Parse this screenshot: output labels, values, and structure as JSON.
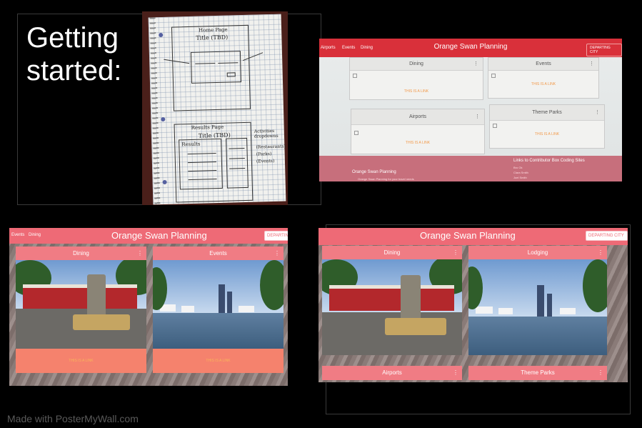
{
  "slide": {
    "title": "Getting started:",
    "watermark": "Made with PosterMyWall.com"
  },
  "sketch": {
    "home_page_label": "Home Page",
    "title_tbd": "Title (TBD)",
    "results_page_label": "Results Page",
    "results_title_tbd": "Title (TBD)",
    "results_label": "Results",
    "activities_note": "Activities dropdowns",
    "activities_items": [
      "(Restaurants)",
      "(Parks)",
      "(Events)"
    ]
  },
  "screen_photo": {
    "nav_links": [
      "Airports",
      "Events",
      "Dining"
    ],
    "brand": "Orange Swan Planning",
    "select_label": "DEPARTING CITY",
    "cards": [
      {
        "title": "Dining",
        "link": "THIS IS A LINK"
      },
      {
        "title": "Events",
        "link": "THIS IS A LINK"
      },
      {
        "title": "Airports",
        "link": "THIS IS A LINK"
      },
      {
        "title": "Theme Parks",
        "link": "THIS IS A LINK"
      }
    ],
    "footer_brand": "Orange Swan Planning",
    "footer_tagline": "Orange Swan Planning for your travel needs",
    "footer_links_title": "Links to Contributor Box Coding Sites",
    "footer_links": [
      "Bro Ok",
      "Clara Smith",
      "Joel Smith"
    ]
  },
  "app_left": {
    "nav_links": [
      "Events",
      "Dining"
    ],
    "brand": "Orange Swan Planning",
    "select_label": "DEPARTING",
    "cards": [
      {
        "title": "Dining",
        "link": "THIS IS A LINK"
      },
      {
        "title": "Events",
        "link": "THIS IS A LINK"
      }
    ]
  },
  "app_right": {
    "brand": "Orange Swan Planning",
    "select_label": "DEPARTING CITY",
    "cards": [
      {
        "title": "Dining"
      },
      {
        "title": "Lodging"
      },
      {
        "title": "Airports"
      },
      {
        "title": "Theme Parks"
      }
    ]
  },
  "colors": {
    "nav_red": "#d9303a",
    "nav_pink": "#ee6a76",
    "card_header": "#f07c84",
    "card_footer": "#f5826d",
    "link_orange": "#f7b65a"
  },
  "icons": {
    "kebab": "kebab-menu-icon",
    "dropdown": "chevron-down-icon"
  }
}
